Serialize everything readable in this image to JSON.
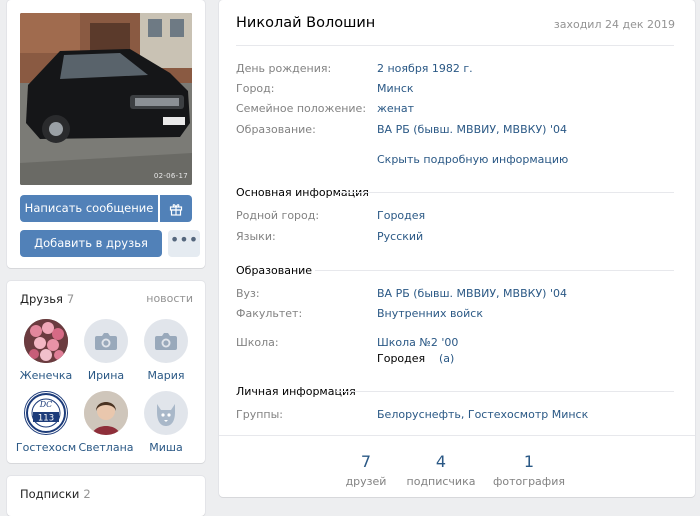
{
  "profile": {
    "name": "Николай Волошин",
    "last_seen": "заходил 24 дек 2019",
    "photo_date": "02-06-17"
  },
  "actions": {
    "message": "Написать сообщение",
    "add_friend": "Добавить в друзья",
    "more": "•••"
  },
  "info": {
    "birthday_label": "День рождения:",
    "birthday": "2 ноября 1982 г.",
    "city_label": "Город:",
    "city": "Минск",
    "family_label": "Семейное положение:",
    "family": "женат",
    "education_label": "Образование:",
    "education": "ВА РБ (бывш. МВВИУ, МВВКУ) '04",
    "toggle": "Скрыть подробную информацию"
  },
  "main_info": {
    "title": "Основная информация",
    "hometown_label": "Родной город:",
    "hometown": "Городея",
    "languages_label": "Языки:",
    "languages": "Русский"
  },
  "education": {
    "title": "Образование",
    "university_label": "Вуз:",
    "university": "ВА РБ (бывш. МВВИУ, МВВКУ) '04",
    "faculty_label": "Факультет:",
    "faculty": "Внутренних войск",
    "school_label": "Школа:",
    "school": "Школа №2 '00",
    "school_city": "Городея",
    "school_class": "(а)"
  },
  "personal": {
    "title": "Личная информация",
    "groups_label": "Группы:",
    "groups": "Белоруснефть, Гостехосмотр Минск"
  },
  "counters": [
    {
      "num": "7",
      "cap": "друзей"
    },
    {
      "num": "4",
      "cap": "подписчика"
    },
    {
      "num": "1",
      "cap": "фотография"
    }
  ],
  "friends": {
    "title": "Друзья",
    "count": "7",
    "link": "новости",
    "items": [
      {
        "name": "Женечка"
      },
      {
        "name": "Ирина"
      },
      {
        "name": "Мария"
      },
      {
        "name": "Гостехосм"
      },
      {
        "name": "Светлана"
      },
      {
        "name": "Миша"
      }
    ],
    "badge_number": "113"
  },
  "subscriptions": {
    "title": "Подписки",
    "count": "2"
  },
  "colors": {
    "accent": "#5181b8",
    "link": "#2a5885",
    "background": "#edeef0"
  },
  "icons": {
    "gift": "gift-icon",
    "camera": "camera-icon",
    "dog": "deactivated-dog-icon"
  }
}
